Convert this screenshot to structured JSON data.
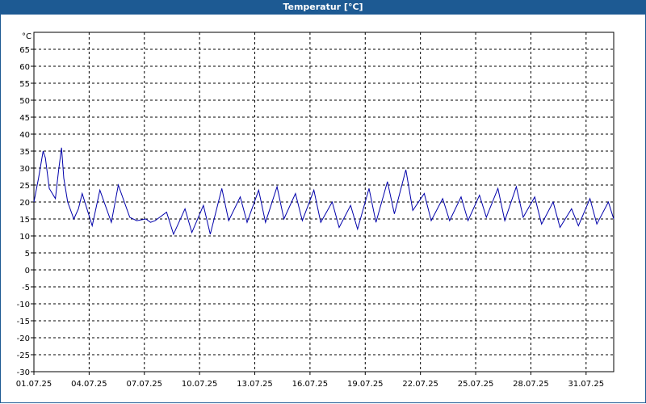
{
  "window": {
    "title": "Temperatur [°C]"
  },
  "chart_data": {
    "type": "line",
    "title": "Temperatur [°C]",
    "ylabel": "°C",
    "ylim": [
      -30,
      70
    ],
    "yticks": [
      -30,
      -25,
      -20,
      -15,
      -10,
      -5,
      0,
      5,
      10,
      15,
      20,
      25,
      30,
      35,
      40,
      45,
      50,
      55,
      60,
      65
    ],
    "xlim": [
      "2025-07-01T00:00",
      "2025-08-01T12:00"
    ],
    "xtick_labels": [
      "01.07.25",
      "04.07.25",
      "07.07.25",
      "10.07.25",
      "13.07.25",
      "16.07.25",
      "19.07.25",
      "22.07.25",
      "25.07.25",
      "28.07.25",
      "31.07.25"
    ],
    "grid": true,
    "series": [
      {
        "color": "#0000aa",
        "x": [
          "2025-07-01T00:00",
          "2025-07-01T06:00",
          "2025-07-01T12:00",
          "2025-07-01T15:00",
          "2025-07-01T20:00",
          "2025-07-02T04:00",
          "2025-07-02T08:00",
          "2025-07-02T12:00",
          "2025-07-02T15:00",
          "2025-07-02T20:00",
          "2025-07-03T04:00",
          "2025-07-03T10:00",
          "2025-07-03T15:00",
          "2025-07-04T04:00",
          "2025-07-04T14:00",
          "2025-07-05T05:00",
          "2025-07-05T14:00",
          "2025-07-06T05:00",
          "2025-07-06T14:00",
          "2025-07-07T02:00",
          "2025-07-07T08:00",
          "2025-07-07T14:00",
          "2025-07-08T05:00",
          "2025-07-08T14:00",
          "2025-07-09T05:00",
          "2025-07-09T14:00",
          "2025-07-10T05:00",
          "2025-07-10T14:00",
          "2025-07-11T05:00",
          "2025-07-11T14:00",
          "2025-07-12T05:00",
          "2025-07-12T14:00",
          "2025-07-13T05:00",
          "2025-07-13T14:00",
          "2025-07-14T05:00",
          "2025-07-14T14:00",
          "2025-07-15T05:00",
          "2025-07-15T14:00",
          "2025-07-16T05:00",
          "2025-07-16T14:00",
          "2025-07-17T05:00",
          "2025-07-17T14:00",
          "2025-07-18T05:00",
          "2025-07-18T14:00",
          "2025-07-19T05:00",
          "2025-07-19T14:00",
          "2025-07-20T05:00",
          "2025-07-20T14:00",
          "2025-07-21T05:00",
          "2025-07-21T14:00",
          "2025-07-22T05:00",
          "2025-07-22T14:00",
          "2025-07-23T05:00",
          "2025-07-23T14:00",
          "2025-07-24T05:00",
          "2025-07-24T14:00",
          "2025-07-25T05:00",
          "2025-07-25T14:00",
          "2025-07-26T05:00",
          "2025-07-26T14:00",
          "2025-07-27T05:00",
          "2025-07-27T14:00",
          "2025-07-28T05:00",
          "2025-07-28T14:00",
          "2025-07-29T05:00",
          "2025-07-29T14:00",
          "2025-07-30T05:00",
          "2025-07-30T14:00",
          "2025-07-31T05:00",
          "2025-07-31T14:00",
          "2025-08-01T05:00",
          "2025-08-01T12:00"
        ],
        "y": [
          20,
          27,
          35,
          33,
          24,
          21,
          29,
          36,
          27,
          20,
          15,
          18,
          22.5,
          13,
          23.5,
          14,
          25,
          15.5,
          14.5,
          15,
          14,
          14.5,
          17,
          10.5,
          18,
          11,
          19,
          10.5,
          24,
          14.5,
          21.5,
          14,
          23.5,
          14,
          24.5,
          15,
          22.5,
          14.5,
          23.5,
          14,
          20,
          12.5,
          19,
          12,
          24,
          14,
          26,
          16.5,
          29.5,
          17.5,
          22.5,
          14.5,
          21,
          14.5,
          21.5,
          14.5,
          22,
          15.5,
          24,
          14.5,
          24.5,
          15.5,
          21.5,
          13.5,
          20,
          12.5,
          18,
          13,
          21,
          13.5,
          20,
          15
        ]
      }
    ]
  }
}
